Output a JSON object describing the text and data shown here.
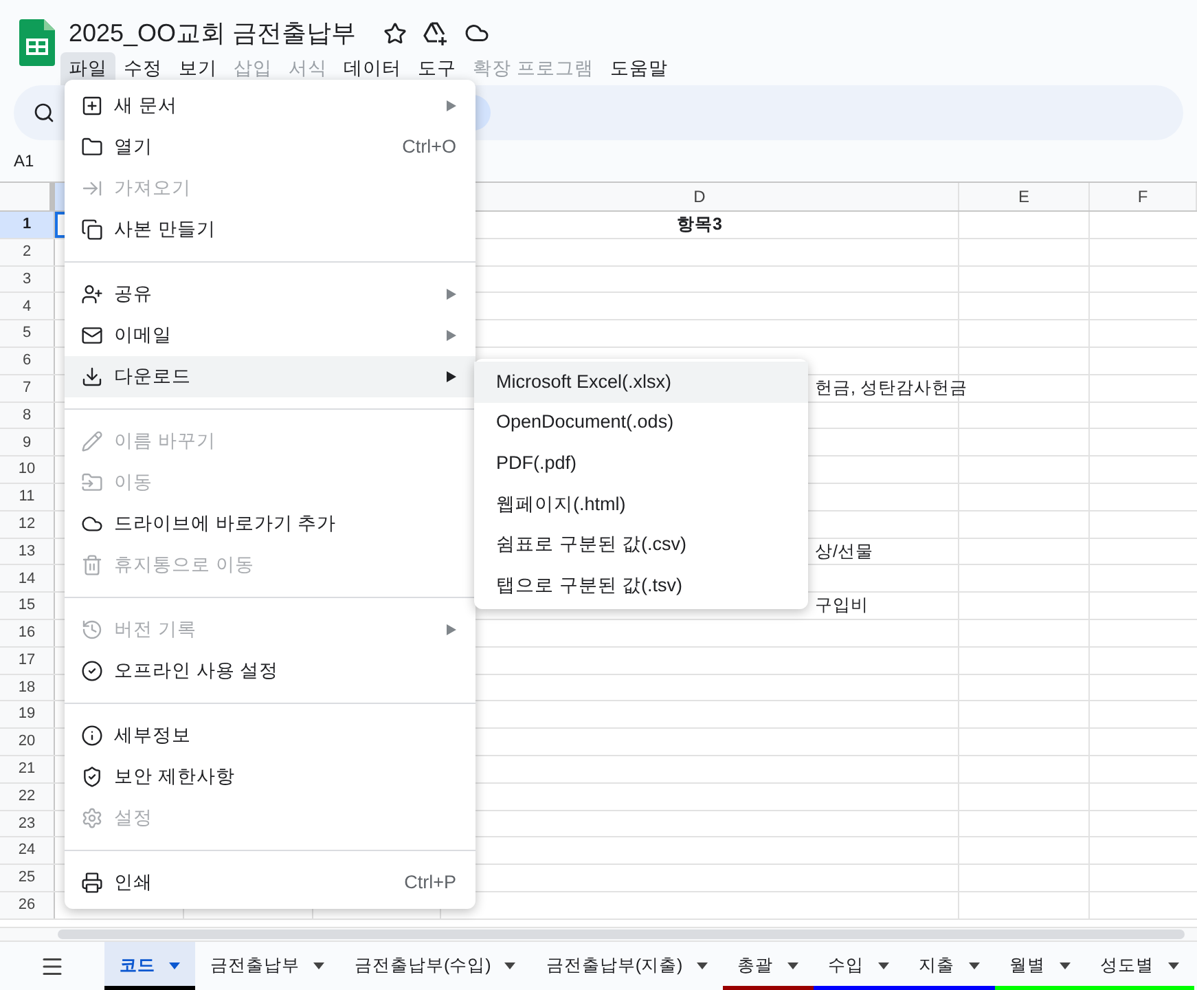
{
  "document": {
    "title": "2025_OO교회 금전출납부"
  },
  "menubar": [
    {
      "label": "파일",
      "selected": true,
      "disabled": false
    },
    {
      "label": "수정",
      "selected": false,
      "disabled": false
    },
    {
      "label": "보기",
      "selected": false,
      "disabled": false
    },
    {
      "label": "삽입",
      "selected": false,
      "disabled": true
    },
    {
      "label": "서식",
      "selected": false,
      "disabled": true
    },
    {
      "label": "데이터",
      "selected": false,
      "disabled": false
    },
    {
      "label": "도구",
      "selected": false,
      "disabled": false
    },
    {
      "label": "확장 프로그램",
      "selected": false,
      "disabled": true
    },
    {
      "label": "도움말",
      "selected": false,
      "disabled": false
    }
  ],
  "name_box": "A1",
  "columns": [
    "D",
    "E",
    "F"
  ],
  "rows": [
    {
      "number": "1",
      "selected": true,
      "cell": "항목3",
      "bold": true
    },
    {
      "number": "2",
      "selected": false
    },
    {
      "number": "3",
      "selected": false
    },
    {
      "number": "4",
      "selected": false
    },
    {
      "number": "5",
      "selected": false
    },
    {
      "number": "6",
      "selected": false
    },
    {
      "number": "7",
      "selected": false,
      "cell": "헌금, 성탄감사헌금",
      "bold": false
    },
    {
      "number": "8",
      "selected": false
    },
    {
      "number": "9",
      "selected": false
    },
    {
      "number": "10",
      "selected": false
    },
    {
      "number": "11",
      "selected": false
    },
    {
      "number": "12",
      "selected": false
    },
    {
      "number": "13",
      "selected": false,
      "cell": "상/선물",
      "bold": false
    },
    {
      "number": "14",
      "selected": false
    },
    {
      "number": "15",
      "selected": false,
      "cell": "구입비",
      "bold": false
    },
    {
      "number": "16",
      "selected": false
    },
    {
      "number": "17",
      "selected": false
    },
    {
      "number": "18",
      "selected": false
    },
    {
      "number": "19",
      "selected": false
    },
    {
      "number": "20",
      "selected": false
    },
    {
      "number": "21",
      "selected": false
    },
    {
      "number": "22",
      "selected": false
    },
    {
      "number": "23",
      "selected": false
    },
    {
      "number": "24",
      "selected": false
    },
    {
      "number": "25",
      "selected": false
    },
    {
      "number": "26",
      "selected": false
    }
  ],
  "file_menu": [
    [
      {
        "label": "새 문서",
        "disabled": false,
        "submenu": true,
        "selected": false
      },
      {
        "label": "열기",
        "disabled": false,
        "shortcut": "Ctrl+O",
        "selected": false
      },
      {
        "label": "가져오기",
        "disabled": true,
        "selected": false
      },
      {
        "label": "사본 만들기",
        "disabled": false,
        "selected": false
      }
    ],
    [
      {
        "label": "공유",
        "disabled": false,
        "submenu": true,
        "selected": false
      },
      {
        "label": "이메일",
        "disabled": false,
        "submenu": true,
        "selected": false
      },
      {
        "label": "다운로드",
        "disabled": false,
        "submenu": true,
        "selected": true
      }
    ],
    [
      {
        "label": "이름 바꾸기",
        "disabled": true,
        "selected": false
      },
      {
        "label": "이동",
        "disabled": true,
        "selected": false
      },
      {
        "label": "드라이브에 바로가기 추가",
        "disabled": false,
        "selected": false
      },
      {
        "label": "휴지통으로 이동",
        "disabled": true,
        "selected": false
      }
    ],
    [
      {
        "label": "버전 기록",
        "disabled": true,
        "submenu": true,
        "selected": false
      },
      {
        "label": "오프라인 사용 설정",
        "disabled": false,
        "selected": false
      }
    ],
    [
      {
        "label": "세부정보",
        "disabled": false,
        "selected": false
      },
      {
        "label": "보안 제한사항",
        "disabled": false,
        "selected": false
      },
      {
        "label": "설정",
        "disabled": true,
        "selected": false
      }
    ],
    [
      {
        "label": "인쇄",
        "disabled": false,
        "shortcut": "Ctrl+P",
        "selected": false
      }
    ]
  ],
  "download_menu": [
    {
      "label": "Microsoft Excel(.xlsx)",
      "selected": true
    },
    {
      "label": "OpenDocument(.ods)",
      "selected": false
    },
    {
      "label": "PDF(.pdf)",
      "selected": false
    },
    {
      "label": "웹페이지(.html)",
      "selected": false
    },
    {
      "label": "쉼표로 구분된 값(.csv)",
      "selected": false
    },
    {
      "label": "탭으로 구분된 값(.tsv)",
      "selected": false
    }
  ],
  "sheet_tabs": [
    {
      "label": "코드",
      "selected": true,
      "color": "#000000"
    },
    {
      "label": "금전출납부",
      "selected": false
    },
    {
      "label": "금전출납부(수입)",
      "selected": false
    },
    {
      "label": "금전출납부(지출)",
      "selected": false
    },
    {
      "label": "총괄",
      "selected": false,
      "color": "#990000"
    },
    {
      "label": "수입",
      "selected": false,
      "color": "#0000ff"
    },
    {
      "label": "지출",
      "selected": false,
      "color": "#0000ff"
    },
    {
      "label": "월별",
      "selected": false,
      "color": "#00ff00"
    },
    {
      "label": "성도별",
      "selected": false,
      "color": "#00ff00"
    }
  ]
}
